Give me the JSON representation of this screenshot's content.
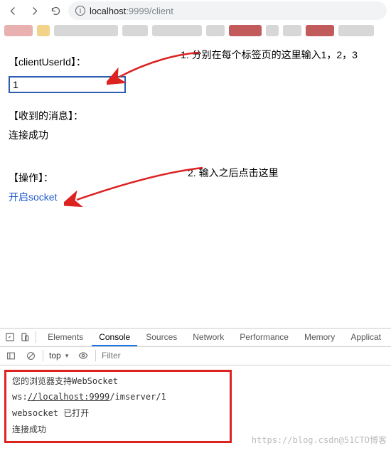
{
  "toolbar": {
    "url_host": "localhost",
    "url_rest": ":9999/client"
  },
  "page": {
    "client_label": "【clientUserId】：",
    "client_value": "1",
    "recv_label": "【收到的消息】：",
    "recv_msg": "连接成功",
    "op_label": "【操作】：",
    "open_socket": "开启socket"
  },
  "anno": {
    "a1": "1. 分别在每个标签页的这里输入1，2，3",
    "a2": "2. 输入之后点击这里"
  },
  "devtools": {
    "tabs": [
      "Elements",
      "Console",
      "Sources",
      "Network",
      "Performance",
      "Memory",
      "Applicat"
    ],
    "active_tab": "Console",
    "scope": "top",
    "filter_placeholder": "Filter",
    "lines": {
      "l1": "您的浏览器支持WebSocket",
      "l2_pre": "ws:",
      "l2_u": "//localhost:9999",
      "l2_post": "/imserver/1",
      "l3": "websocket 已打开",
      "l4": "连接成功"
    }
  },
  "watermark": "https://blog.csdn@51CTO博客"
}
